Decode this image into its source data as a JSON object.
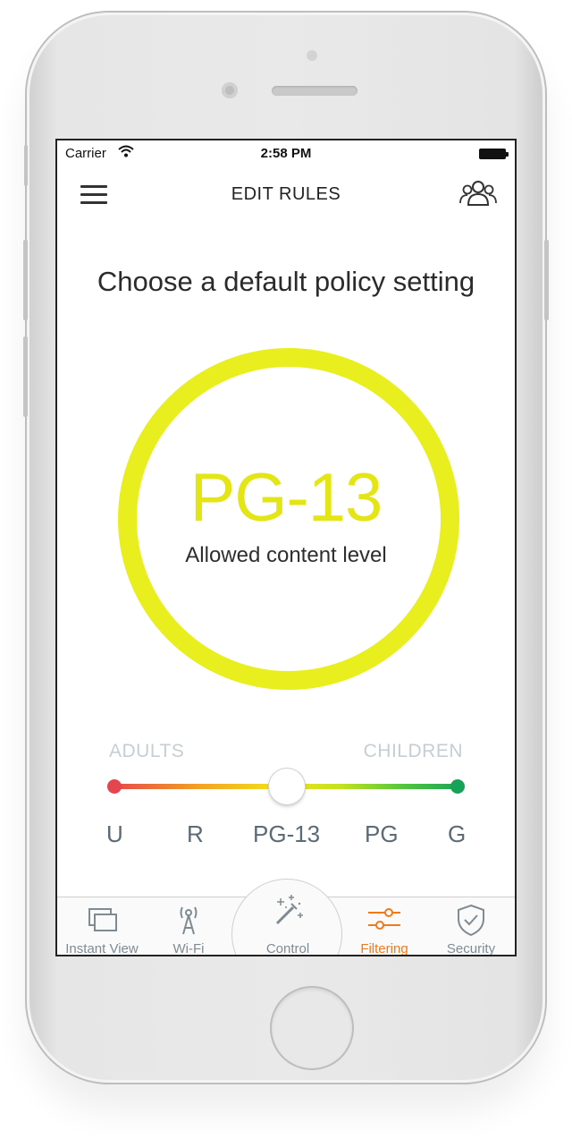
{
  "status_bar": {
    "carrier": "Carrier",
    "time": "2:58 PM"
  },
  "nav": {
    "title": "EDIT RULES"
  },
  "heading": "Choose a default policy setting",
  "rating": {
    "level": "PG-13",
    "subtitle": "Allowed content level",
    "ring_color": "#e9ef1e"
  },
  "slider": {
    "left_label": "ADULTS",
    "right_label": "CHILDREN",
    "ticks": [
      "U",
      "R",
      "PG-13",
      "PG",
      "G"
    ],
    "selected": "PG-13",
    "value_fraction": 0.5
  },
  "tabs": [
    {
      "label": "Instant View",
      "icon": "instant-view-icon",
      "active": false
    },
    {
      "label": "Wi-Fi",
      "icon": "wifi-antenna-icon",
      "active": false
    },
    {
      "label": "Control",
      "icon": "magic-wand-icon",
      "active": false
    },
    {
      "label": "Filtering",
      "icon": "sliders-icon",
      "active": true
    },
    {
      "label": "Security",
      "icon": "shield-check-icon",
      "active": false
    }
  ],
  "colors": {
    "accent": "#f07a1a",
    "rating": "#e3e514",
    "tick_text": "#5b6a74"
  }
}
